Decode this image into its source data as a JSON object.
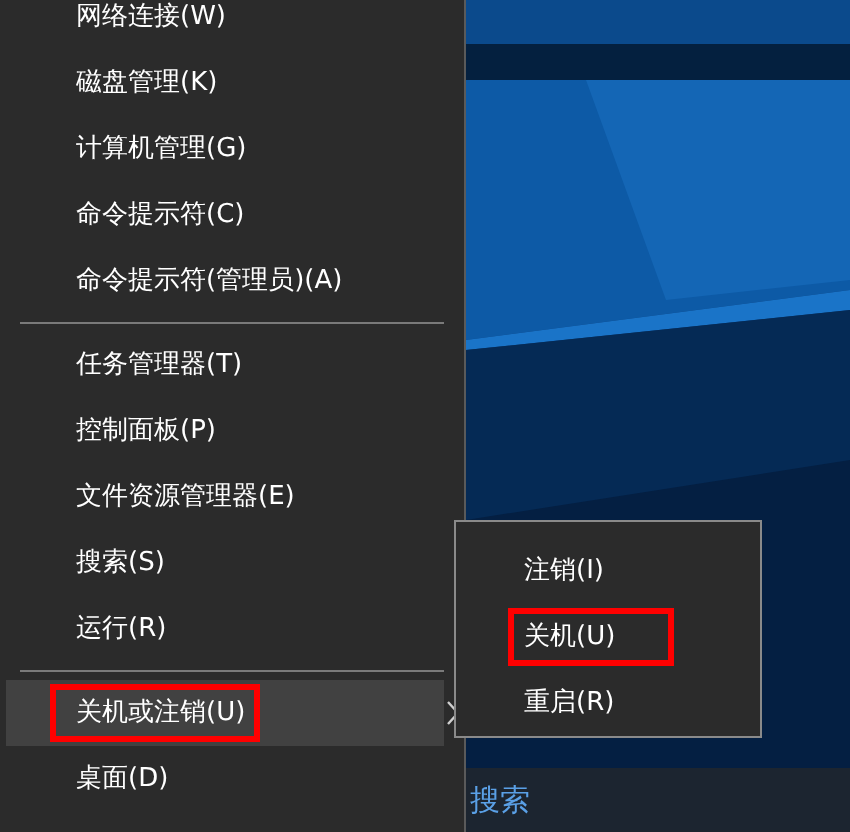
{
  "menu": {
    "items": [
      {
        "kind": "item",
        "label": "网络连接(W)",
        "hovered": false,
        "highlighted": false,
        "has_submenu": false
      },
      {
        "kind": "item",
        "label": "磁盘管理(K)",
        "hovered": false,
        "highlighted": false,
        "has_submenu": false
      },
      {
        "kind": "item",
        "label": "计算机管理(G)",
        "hovered": false,
        "highlighted": false,
        "has_submenu": false
      },
      {
        "kind": "item",
        "label": "命令提示符(C)",
        "hovered": false,
        "highlighted": false,
        "has_submenu": false
      },
      {
        "kind": "item",
        "label": "命令提示符(管理员)(A)",
        "hovered": false,
        "highlighted": false,
        "has_submenu": false
      },
      {
        "kind": "separator"
      },
      {
        "kind": "item",
        "label": "任务管理器(T)",
        "hovered": false,
        "highlighted": false,
        "has_submenu": false
      },
      {
        "kind": "item",
        "label": "控制面板(P)",
        "hovered": false,
        "highlighted": false,
        "has_submenu": false
      },
      {
        "kind": "item",
        "label": "文件资源管理器(E)",
        "hovered": false,
        "highlighted": false,
        "has_submenu": false
      },
      {
        "kind": "item",
        "label": "搜索(S)",
        "hovered": false,
        "highlighted": false,
        "has_submenu": false
      },
      {
        "kind": "item",
        "label": "运行(R)",
        "hovered": false,
        "highlighted": false,
        "has_submenu": false
      },
      {
        "kind": "separator"
      },
      {
        "kind": "item",
        "label": "关机或注销(U)",
        "hovered": true,
        "highlighted": true,
        "has_submenu": true
      },
      {
        "kind": "item",
        "label": "桌面(D)",
        "hovered": false,
        "highlighted": false,
        "has_submenu": false
      }
    ]
  },
  "submenu": {
    "items": [
      {
        "label": "注销(I)",
        "highlighted": false
      },
      {
        "label": "关机(U)",
        "highlighted": true
      },
      {
        "label": "重启(R)",
        "highlighted": false
      }
    ]
  },
  "taskbar": {
    "search_text": "搜索"
  }
}
